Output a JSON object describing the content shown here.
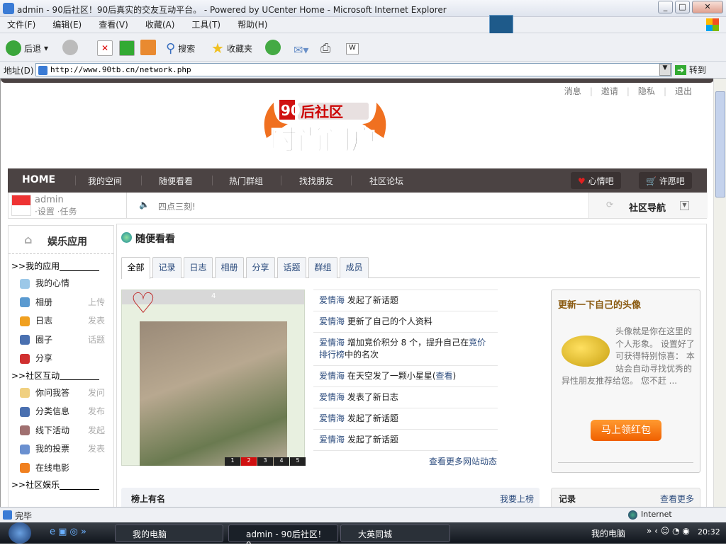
{
  "window": {
    "title": "admin - 90后社区！90后真实的交友互动平台。 - Powered by UCenter Home - Microsoft Internet Explorer"
  },
  "menu": [
    "文件(F)",
    "编辑(E)",
    "查看(V)",
    "收藏(A)",
    "工具(T)",
    "帮助(H)"
  ],
  "toolbar": {
    "back": "后退",
    "search": "搜索",
    "favorites": "收藏夹"
  },
  "address": {
    "label": "地址(D)",
    "url": "http://www.90tb.cn/network.php",
    "go": "转到"
  },
  "top_links": [
    "消息",
    "邀请",
    "隐私",
    "退出"
  ],
  "logo": {
    "text": "90后社区 时尚门户",
    "site": "www.90tb.cn"
  },
  "nav": {
    "home": "HOME",
    "items": [
      "我的空间",
      "随便看看",
      "热门群组",
      "找找朋友",
      "社区论坛"
    ],
    "mood": "心情吧",
    "wish": "许愿吧"
  },
  "user": {
    "name": "admin",
    "links": "·设置 ·任务",
    "announcement": "四点三刻!",
    "community_nav": "社区导航"
  },
  "sidebar": {
    "title": "娱乐应用",
    "groups": [
      {
        "title": ">>我的应用",
        "items": [
          {
            "label": "我的心情",
            "action": ""
          },
          {
            "label": "相册",
            "action": "上传"
          },
          {
            "label": "日志",
            "action": "发表"
          },
          {
            "label": "圈子",
            "action": "话题"
          },
          {
            "label": "分享",
            "action": ""
          }
        ]
      },
      {
        "title": ">>社区互动",
        "items": [
          {
            "label": "你问我答",
            "action": "发问"
          },
          {
            "label": "分类信息",
            "action": "发布"
          },
          {
            "label": "线下活动",
            "action": "发起"
          },
          {
            "label": "我的投票",
            "action": "发表"
          },
          {
            "label": "在线电影",
            "action": ""
          }
        ]
      },
      {
        "title": ">>社区娱乐",
        "items": []
      }
    ]
  },
  "main": {
    "title": "随便看看",
    "tabs": [
      "全部",
      "记录",
      "日志",
      "相册",
      "分享",
      "话题",
      "群组",
      "成员"
    ],
    "photo": {
      "counter": "4",
      "pages": [
        "1",
        "2",
        "3",
        "4",
        "5"
      ],
      "active_page": "2"
    },
    "feed": [
      {
        "user": "爱情海",
        "text": "发起了新话题"
      },
      {
        "user": "爱情海",
        "text": "更新了自己的个人资料"
      },
      {
        "user": "爱情海",
        "text": "增加竞价积分 8 个，提升自己在",
        "link": "竞价排行榜",
        "tail": "中的名次"
      },
      {
        "user": "爱情海",
        "text": "在天空发了一颗小星星(",
        "link": "查看",
        "tail": ")"
      },
      {
        "user": "爱情海",
        "text": "发表了新日志"
      },
      {
        "user": "爱情海",
        "text": "发起了新话题"
      },
      {
        "user": "爱情海",
        "text": "发起了新话题"
      }
    ],
    "more": "查看更多网站动态",
    "rank": {
      "title": "榜上有名",
      "action": "我要上榜"
    },
    "avatar_box": {
      "title": "更新一下自己的头像",
      "text": "头像就是你在这里的个人形象。 设置好了可获得特别惊喜： 本站会自动寻找优秀的异性朋友推荐给您。 您不赶 ...",
      "button": "马上领红包"
    },
    "records": {
      "title": "记录",
      "more": "查看更多"
    }
  },
  "status": {
    "text": "完毕",
    "zone": "Internet"
  },
  "taskbar": {
    "buttons": [
      "我的电脑",
      "admin - 90后社区！9...",
      "大英同城"
    ],
    "tray_label": "我的电脑",
    "clock": "20:32"
  }
}
